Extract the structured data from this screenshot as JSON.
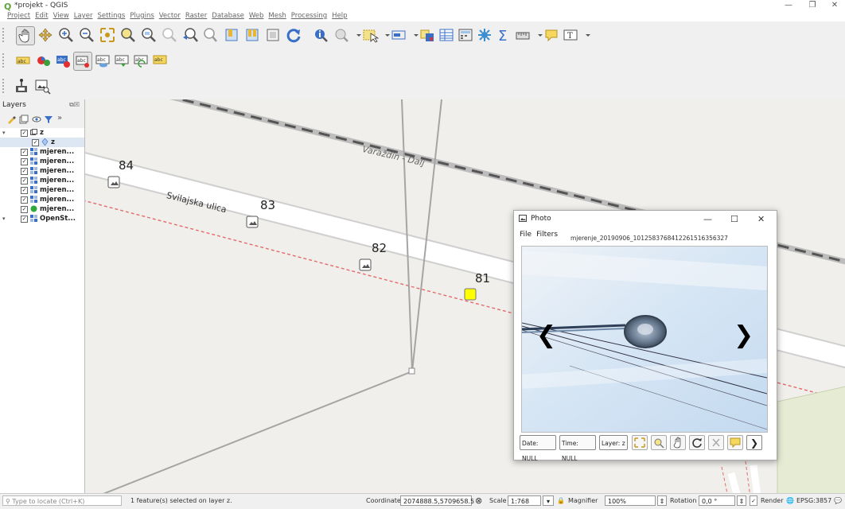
{
  "window": {
    "title": "*projekt - QGIS",
    "min": "—",
    "restore": "❐",
    "close": "✕"
  },
  "menu": [
    "Project",
    "Edit",
    "View",
    "Layer",
    "Settings",
    "Plugins",
    "Vector",
    "Raster",
    "Database",
    "Web",
    "Mesh",
    "Processing",
    "Help"
  ],
  "layers_panel": {
    "title": "Layers",
    "items": [
      {
        "label": "z",
        "indent": 0,
        "expanded": true,
        "checked": true,
        "icon": "group-icon"
      },
      {
        "label": "z",
        "indent": 1,
        "checked": true,
        "icon": "point-layer-icon",
        "selected": true
      },
      {
        "label": "mjeren...",
        "indent": 0,
        "checked": true,
        "icon": "raster-icon"
      },
      {
        "label": "mjeren...",
        "indent": 0,
        "checked": true,
        "icon": "raster-icon"
      },
      {
        "label": "mjeren...",
        "indent": 0,
        "checked": true,
        "icon": "raster-icon"
      },
      {
        "label": "mjeren...",
        "indent": 0,
        "checked": true,
        "icon": "raster-icon"
      },
      {
        "label": "mjeren...",
        "indent": 0,
        "checked": true,
        "icon": "raster-icon"
      },
      {
        "label": "mjeren...",
        "indent": 0,
        "checked": true,
        "icon": "raster-icon"
      },
      {
        "label": "mjeren...",
        "indent": 0,
        "checked": true,
        "icon": "green-point-icon"
      },
      {
        "label": "OpenSt...",
        "indent": 0,
        "checked": true,
        "icon": "raster-icon",
        "expanded": true
      }
    ]
  },
  "map": {
    "street_label": "Svilajska ulica",
    "rail_label": "Varaždin - Dalj",
    "points": [
      "84",
      "83",
      "82",
      "81"
    ],
    "selected_point": "81",
    "selected_color": "#ffff00"
  },
  "photo_window": {
    "title": "Photo",
    "menu": [
      "File",
      "Filters"
    ],
    "filename": "mjerenje_20190906_101258376841226151635632​7",
    "prev": "❮",
    "next": "❯",
    "date": "Date: NULL",
    "time": "Time: NULL",
    "layer": "Layer: z",
    "next_button": "❯"
  },
  "status": {
    "locate_placeholder": "Type to locate (Ctrl+K)",
    "message": "1 feature(s) selected on layer z.",
    "coordinate_label": "Coordinate",
    "coordinate": "2074888.5,5709658.5",
    "scale_label": "Scale",
    "scale": "1:768",
    "magnifier_label": "Magnifier",
    "magnifier": "100%",
    "rotation_label": "Rotation",
    "rotation": "0,0 °",
    "render_label": "Render",
    "crs": "EPSG:3857"
  }
}
